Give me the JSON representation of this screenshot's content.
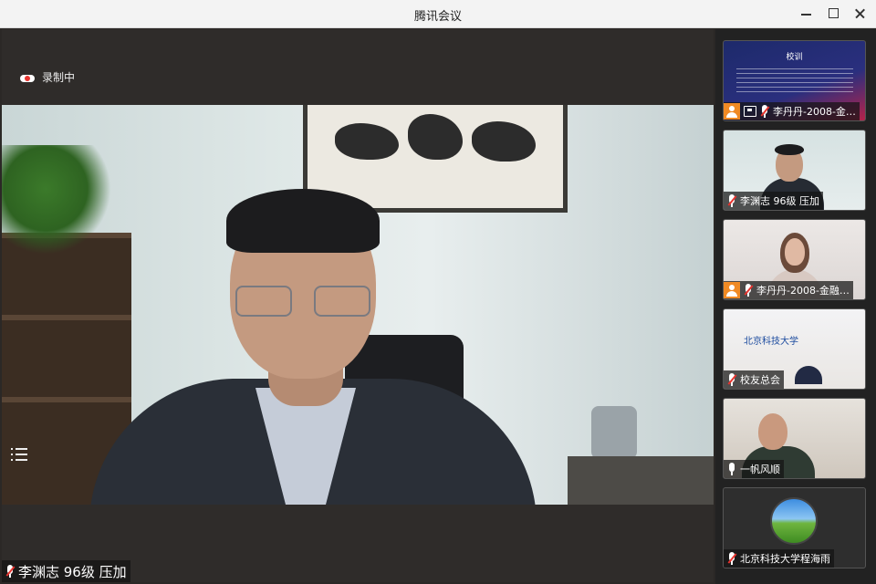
{
  "window": {
    "title": "腾讯会议"
  },
  "stage": {
    "recording_label": "录制中",
    "speaker_name": "李渊志 96级 压加"
  },
  "participants": [
    {
      "name": "李丹丹-2008-金…",
      "badges": [
        "person",
        "share"
      ],
      "mic": "muted"
    },
    {
      "name": "李渊志 96级 压加",
      "badges": [],
      "mic": "muted"
    },
    {
      "name": "李丹丹-2008-金融…",
      "badges": [
        "person"
      ],
      "mic": "muted"
    },
    {
      "name": "校友总会",
      "badges": [],
      "mic": "muted"
    },
    {
      "name": "一帆风顺",
      "badges": [],
      "mic": "on"
    },
    {
      "name": "北京科技大学程海雨",
      "badges": [],
      "mic": "muted"
    }
  ],
  "slide": {
    "title": "校训"
  },
  "sign_text": "北京科技大学"
}
